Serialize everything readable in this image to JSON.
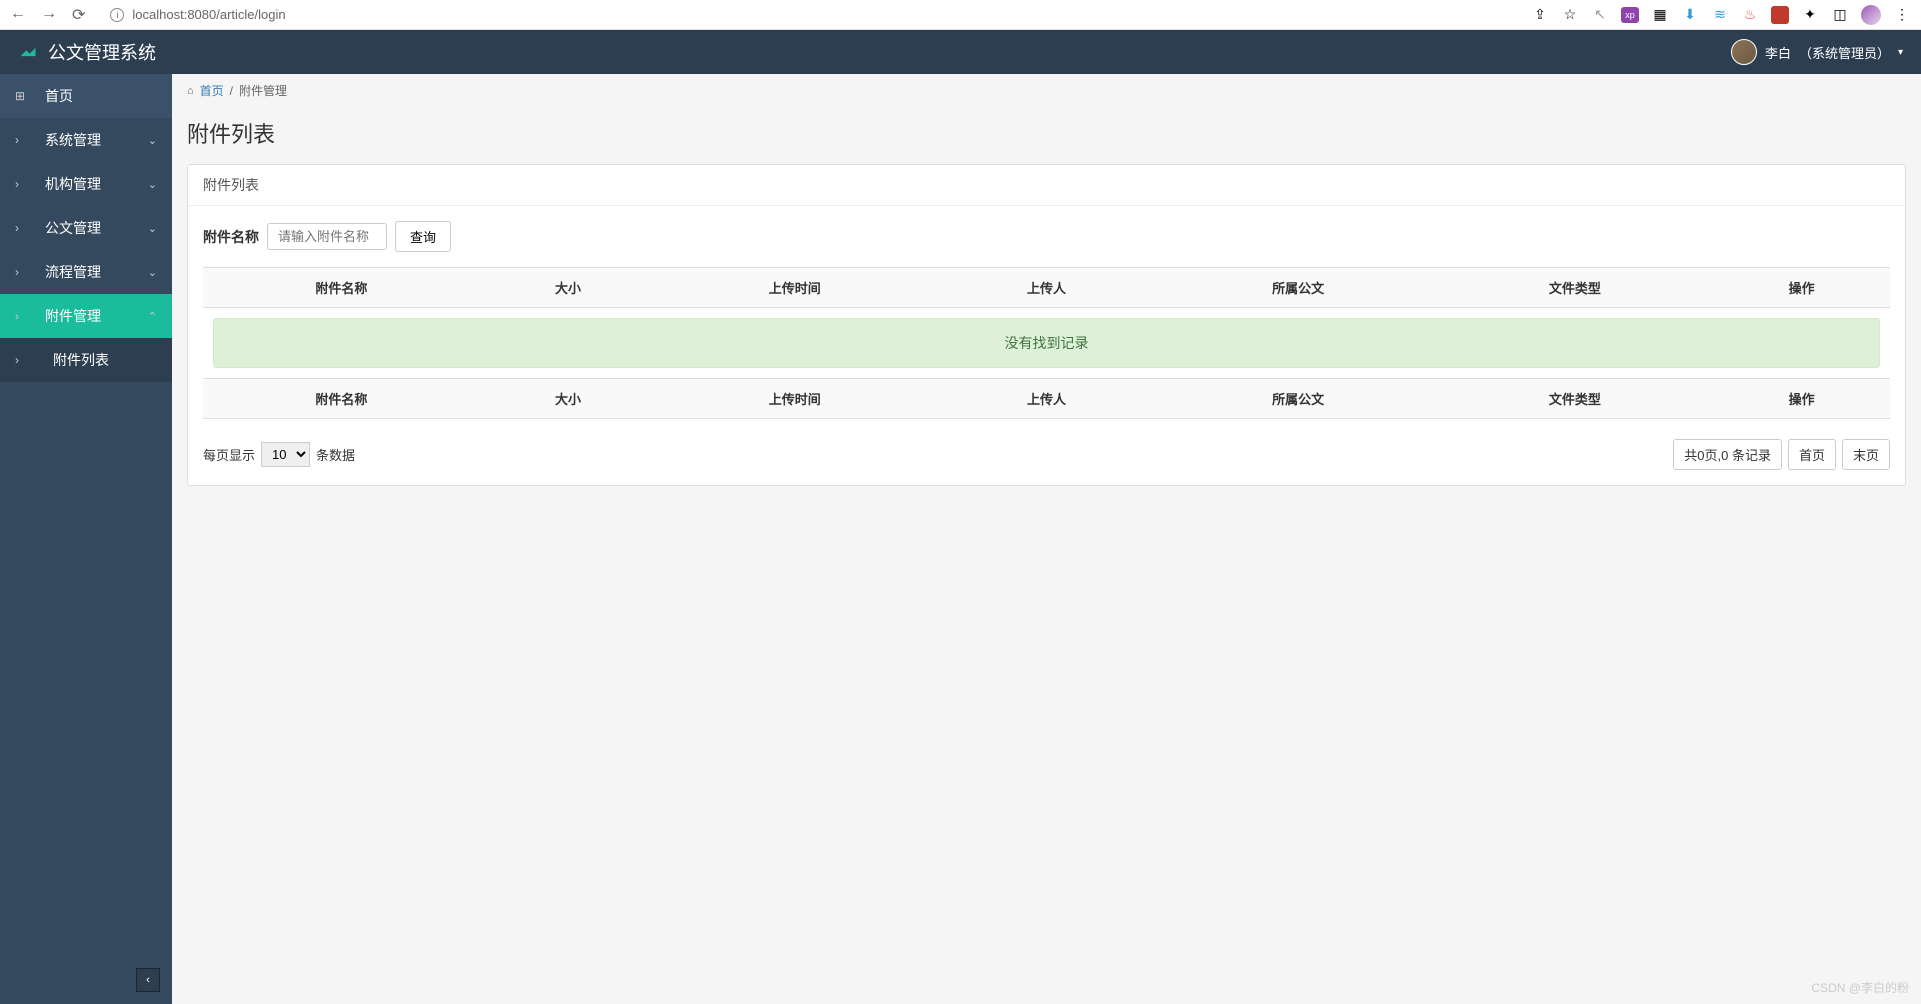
{
  "browser": {
    "url": "localhost:8080/article/login",
    "ext_icons": [
      "share-icon",
      "star-icon",
      "cursor-icon",
      "xp-icon",
      "wallet-icon",
      "download-icon",
      "stack-icon",
      "sitemap-icon",
      "shield-icon",
      "puzzle-icon",
      "panel-icon",
      "profile-icon",
      "menu-icon"
    ]
  },
  "header": {
    "app_title": "公文管理系统",
    "user_name": "李白",
    "user_role": "（系统管理员）"
  },
  "sidebar": {
    "items": [
      {
        "label": "首页",
        "icon": "dashboard-icon",
        "type": "home"
      },
      {
        "label": "系统管理",
        "icon": "chevron-right-icon",
        "type": "menu",
        "caret": "down"
      },
      {
        "label": "机构管理",
        "icon": "chevron-right-icon",
        "type": "menu",
        "caret": "down"
      },
      {
        "label": "公文管理",
        "icon": "chevron-right-icon",
        "type": "menu",
        "caret": "down"
      },
      {
        "label": "流程管理",
        "icon": "chevron-right-icon",
        "type": "menu",
        "caret": "down"
      },
      {
        "label": "附件管理",
        "icon": "chevron-right-icon",
        "type": "menu",
        "caret": "up",
        "active": true
      },
      {
        "label": "附件列表",
        "icon": "chevron-right-icon",
        "type": "sub"
      }
    ]
  },
  "breadcrumb": {
    "home": "首页",
    "current": "附件管理"
  },
  "page": {
    "title": "附件列表",
    "panel_header": "附件列表",
    "search_label": "附件名称",
    "search_placeholder": "请输入附件名称",
    "search_button": "查询",
    "columns": [
      "附件名称",
      "大小",
      "上传时间",
      "上传人",
      "所属公文",
      "文件类型",
      "操作"
    ],
    "empty_message": "没有找到记录",
    "pagination": {
      "prefix": "每页显示",
      "page_size": "10",
      "suffix": "条数据",
      "info": "共0页,0 条记录",
      "first": "首页",
      "last": "末页"
    }
  },
  "watermark": "CSDN @李白的粉"
}
